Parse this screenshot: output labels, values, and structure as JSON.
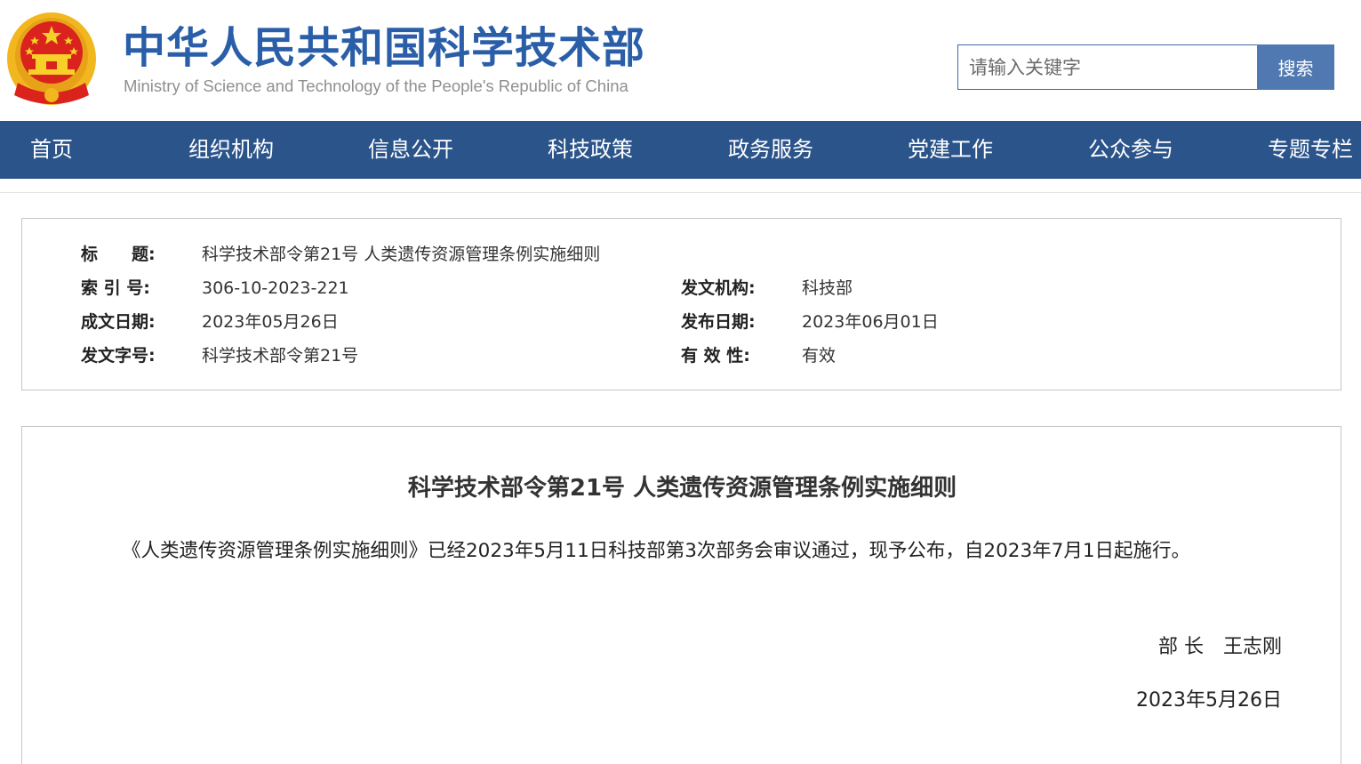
{
  "header": {
    "title": "中华人民共和国科学技术部",
    "subtitle": "Ministry of Science and Technology of the People's Republic of China",
    "emblem_icon": "national-emblem-icon"
  },
  "search": {
    "placeholder": "请输入关键字",
    "button_label": "搜索"
  },
  "nav": {
    "items": [
      {
        "label": "首页"
      },
      {
        "label": "组织机构"
      },
      {
        "label": "信息公开"
      },
      {
        "label": "科技政策"
      },
      {
        "label": "政务服务"
      },
      {
        "label": "党建工作"
      },
      {
        "label": "公众参与"
      },
      {
        "label": "专题专栏"
      }
    ]
  },
  "meta": {
    "title_label": "标　　题:",
    "title_value": "科学技术部令第21号 人类遗传资源管理条例实施细则",
    "index_label": "索 引 号:",
    "index_value": "306-10-2023-221",
    "issuer_label": "发文机构:",
    "issuer_value": "科技部",
    "written_date_label": "成文日期:",
    "written_date_value": "2023年05月26日",
    "publish_date_label": "发布日期:",
    "publish_date_value": "2023年06月01日",
    "doc_number_label": "发文字号:",
    "doc_number_value": "科学技术部令第21号",
    "validity_label": "有 效 性:",
    "validity_value": "有效"
  },
  "document": {
    "title": "科学技术部令第21号 人类遗传资源管理条例实施细则",
    "paragraph": "《人类遗传资源管理条例实施细则》已经2023年5月11日科技部第3次部务会审议通过，现予公布，自2023年7月1日起施行。",
    "signature": "部 长　王志刚",
    "date": "2023年5月26日"
  },
  "colors": {
    "brand_blue": "#2a5ea8",
    "nav_bg": "#2b548b",
    "search_button": "#4f79b0",
    "emblem_red": "#d9231c",
    "emblem_gold": "#f2b71f"
  }
}
